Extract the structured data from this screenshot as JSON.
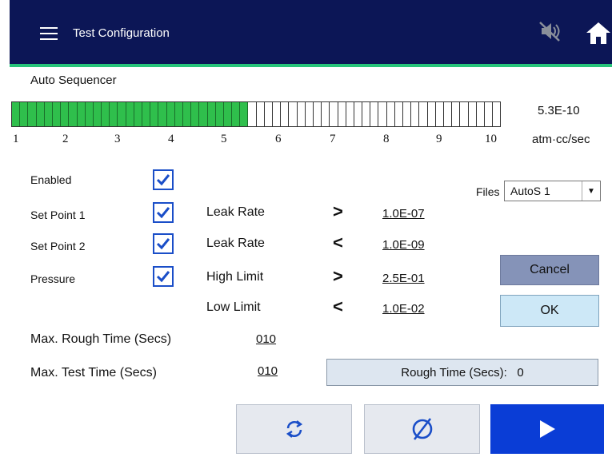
{
  "header": {
    "title": "Test Configuration",
    "menu_icon": "hamburger-menu-icon",
    "mute_icon": "speaker-muted-icon",
    "home_icon": "home-icon",
    "bg_color": "#0c1656",
    "accent_line_color": "#27c47a"
  },
  "sequencer": {
    "title": "Auto Sequencer",
    "bar": {
      "total_segments": 60,
      "filled_segments": 29,
      "fill_color": "#2fbf4c",
      "scale_labels": [
        "1",
        "2",
        "3",
        "4",
        "5",
        "6",
        "7",
        "8",
        "9",
        "10"
      ]
    },
    "reading_value": "5.3E-10",
    "reading_unit": "atm·cc/sec"
  },
  "rows": [
    {
      "label": "Enabled",
      "checked": true
    },
    {
      "label": "Set Point 1",
      "checked": true,
      "param": "Leak Rate",
      "comparator": ">",
      "value": "1.0E-07"
    },
    {
      "label": "Set Point 2",
      "checked": true,
      "param": "Leak Rate",
      "comparator": "<",
      "value": "1.0E-09"
    },
    {
      "label": "Pressure",
      "checked": true,
      "param": "High Limit",
      "comparator": ">",
      "value": "2.5E-01"
    },
    {
      "param": "Low Limit",
      "comparator": "<",
      "value": "1.0E-02"
    }
  ],
  "times": {
    "rough_label": "Max. Rough Time (Secs)",
    "rough_value": "010",
    "test_label": "Max. Test Time (Secs)",
    "test_value": "010"
  },
  "files": {
    "label": "Files",
    "selected": "AutoS 1"
  },
  "buttons": {
    "cancel": "Cancel",
    "ok": "OK"
  },
  "status": {
    "rough_time_text": "Rough Time (Secs):   0"
  },
  "actions": {
    "reset_icon": "refresh-icon",
    "stop_icon": "empty-set-icon",
    "start_icon": "play-icon",
    "start_color": "#0a3dd6"
  }
}
